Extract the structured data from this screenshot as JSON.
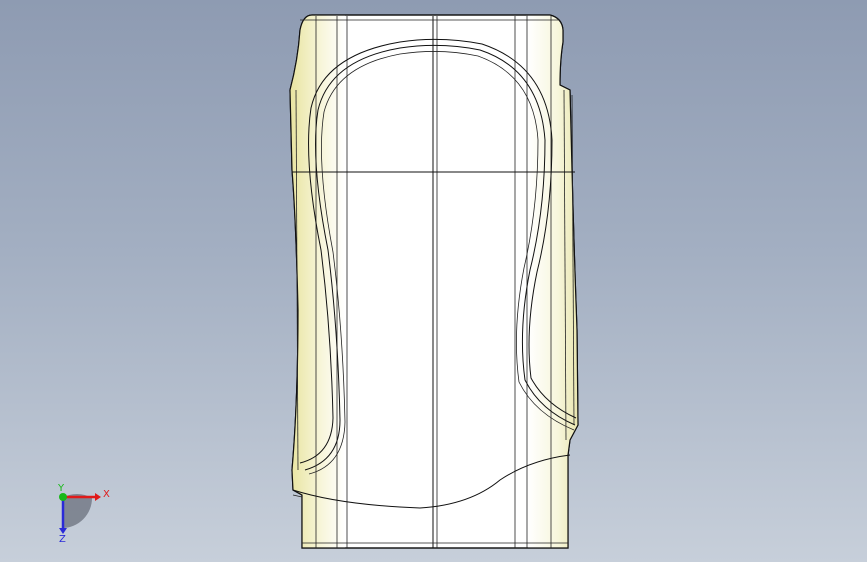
{
  "viewport": {
    "background_top": "#8e9bb2",
    "background_bottom": "#c7cfda"
  },
  "model": {
    "name": "bottle-model",
    "face_color": "#ffffff",
    "shade_color": "#f3f1c8",
    "edge_color": "#111111"
  },
  "triad": {
    "x_label": "X",
    "y_label": "Y",
    "z_label": "Z",
    "x_color": "#e01a1a",
    "y_color": "#18b818",
    "z_color": "#2a2ad8"
  }
}
